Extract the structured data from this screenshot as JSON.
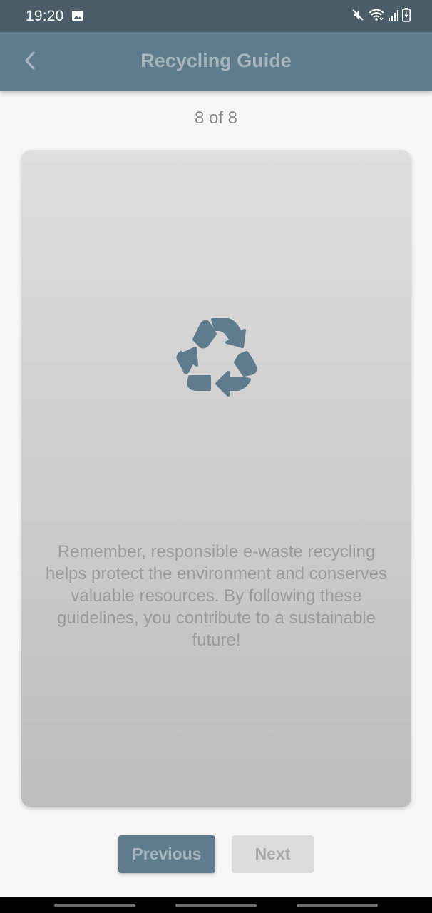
{
  "status_bar": {
    "time": "19:20",
    "icons": [
      "gallery-icon",
      "mute-icon",
      "wifi-icon",
      "signal-icon",
      "battery-charging-icon"
    ]
  },
  "app_bar": {
    "title": "Recycling Guide",
    "back_icon": "chevron-left-icon"
  },
  "page_counter": "8 of 8",
  "card": {
    "icon": "recycle-icon",
    "text": "Remember, responsible e-waste recycling helps protect the environment and conserves valuable resources. By following these guidelines, you contribute to a sustainable future!"
  },
  "buttons": {
    "previous_label": "Previous",
    "next_label": "Next"
  },
  "colors": {
    "status_bar": "#4a5d68",
    "app_bar": "#5e7c8c",
    "accent": "#5e7c8c",
    "background": "#f7f7f7"
  }
}
